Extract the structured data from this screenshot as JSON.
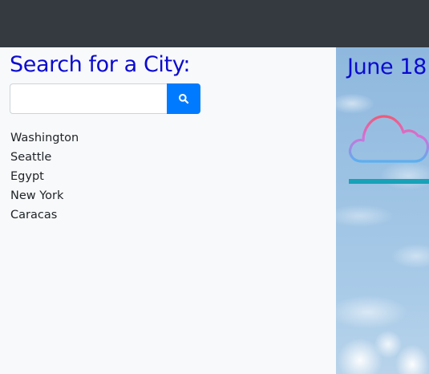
{
  "search": {
    "title": "Search for a City:",
    "input_value": "",
    "placeholder": "",
    "button_icon": "search-icon"
  },
  "cities": [
    "Washington",
    "Seattle",
    "Egypt",
    "New York",
    "Caracas"
  ],
  "weather": {
    "date": "June 18",
    "icon": "cloud-icon",
    "bar_color": "#17a2b8"
  },
  "colors": {
    "topbar": "#343a40",
    "title": "#0b0bd0",
    "button": "#007bff",
    "sidebar": "#f8f9fa"
  }
}
